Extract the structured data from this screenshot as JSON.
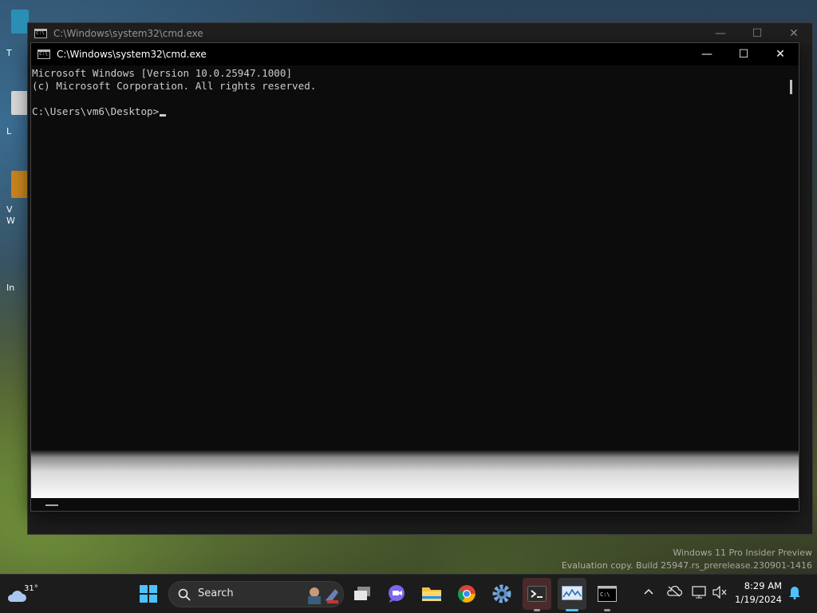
{
  "desktop": {
    "fragments": [
      "T",
      "L",
      "V",
      "W",
      "In"
    ]
  },
  "watermark": {
    "line1": "Windows 11 Pro Insider Preview",
    "line2": "Evaluation copy. Build 25947.rs_prerelease.230901-1416"
  },
  "back_window": {
    "title": "C:\\Windows\\system32\\cmd.exe"
  },
  "front_window": {
    "title": "C:\\Windows\\system32\\cmd.exe",
    "console_lines": [
      "Microsoft Windows [Version 10.0.25947.1000]",
      "(c) Microsoft Corporation. All rights reserved.",
      "",
      "C:\\Users\\vm6\\Desktop>"
    ]
  },
  "caption": {
    "minimize": "—",
    "maximize": "☐",
    "close": "✕"
  },
  "taskbar": {
    "weather_temp": "31°",
    "search_label": "Search",
    "clock_time": "8:29 AM",
    "clock_date": "1/19/2024",
    "apps": [
      {
        "name": "start-button",
        "icon": "windows-logo-icon"
      },
      {
        "name": "task-view-button",
        "icon": "task-view-icon"
      },
      {
        "name": "teams-chat-button",
        "icon": "chat-icon"
      },
      {
        "name": "file-explorer-button",
        "icon": "folder-icon"
      },
      {
        "name": "chrome-button",
        "icon": "chrome-icon"
      },
      {
        "name": "settings-button",
        "icon": "gear-icon"
      },
      {
        "name": "terminal-button",
        "icon": "terminal-icon"
      },
      {
        "name": "performance-monitor-button",
        "icon": "monitor-graph-icon"
      },
      {
        "name": "cmd-button",
        "icon": "cmd-icon"
      }
    ],
    "colors": {
      "accent": "#4cc2ff",
      "taskbar_bg": "#1c1c1c"
    }
  }
}
